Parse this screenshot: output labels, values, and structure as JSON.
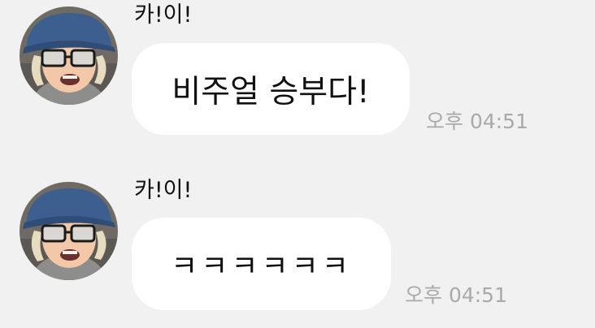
{
  "messages": [
    {
      "sender": "카!이!",
      "text": "비주얼 승부다!",
      "time": "오후 04:51",
      "avatar_icon": "profile-photo-person-with-cap-and-glasses"
    },
    {
      "sender": "카!이!",
      "text": "ㅋㅋㅋㅋㅋㅋ",
      "time": "오후 04:51",
      "avatar_icon": "profile-photo-person-with-cap-and-glasses"
    }
  ],
  "colors": {
    "background": "#f1f1f1",
    "bubble": "#ffffff",
    "timestamp": "#a9a9a9"
  }
}
